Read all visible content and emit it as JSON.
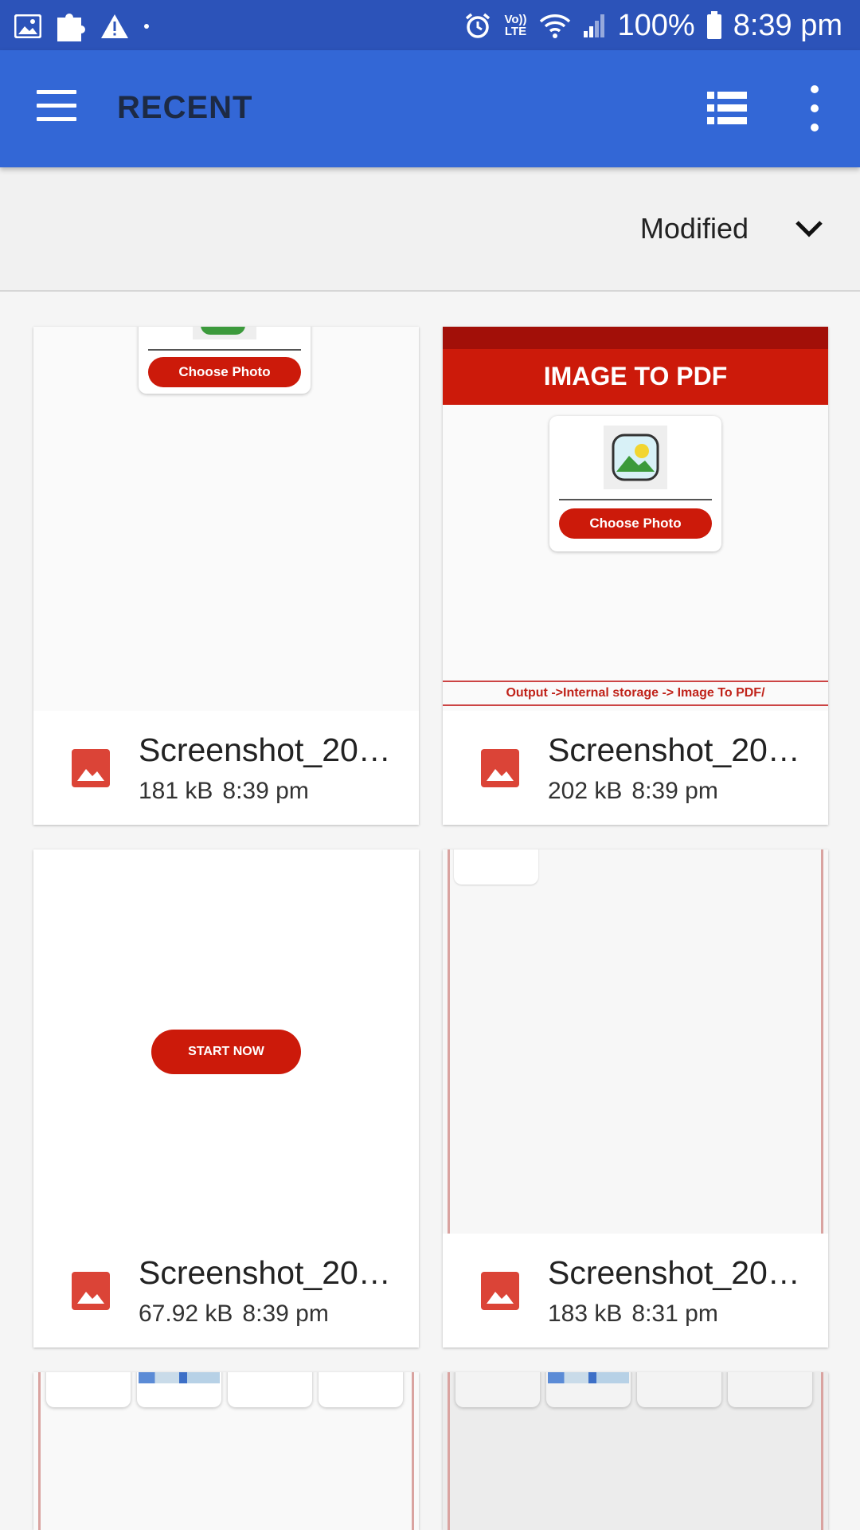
{
  "status_bar": {
    "battery": "100%",
    "time": "8:39 pm",
    "volte": "Vo)) LTE"
  },
  "appbar": {
    "title": "RECENT"
  },
  "sort": {
    "label": "Modified"
  },
  "files": [
    {
      "name": "Screenshot_20…",
      "size": "181 kB",
      "time": "8:39 pm"
    },
    {
      "name": "Screenshot_20…",
      "size": "202 kB",
      "time": "8:39 pm"
    },
    {
      "name": "Screenshot_20…",
      "size": "67.92 kB",
      "time": "8:39 pm"
    },
    {
      "name": "Screenshot_20…",
      "size": "183 kB",
      "time": "8:31 pm"
    }
  ],
  "thumbnails": {
    "choose_photo": "Choose Photo",
    "image_to_pdf": "IMAGE TO PDF",
    "output_path": "Output ->Internal storage -> Image To PDF/",
    "start_now": "START NOW"
  },
  "colors": {
    "status_bar": "#2c53b9",
    "app_bar": "#3367d6",
    "accent_red": "#cc1a0a",
    "file_icon": "#db4437"
  }
}
